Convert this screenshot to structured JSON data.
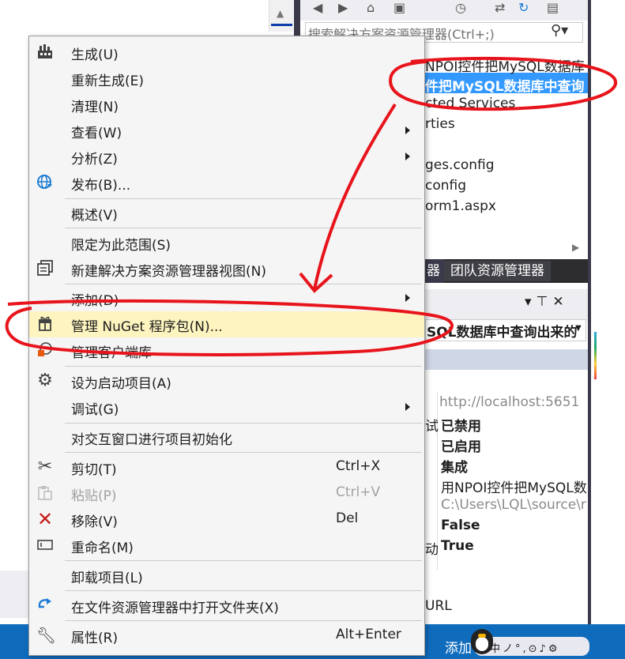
{
  "solution_explorer": {
    "search_placeholder": "搜索解决方案资源管理器(Ctrl+;)",
    "tree": [
      "NPOI控件把MySQL数据库",
      "件把MySQL数据库中查询",
      "cted Services",
      "rties",
      "ges.config",
      "config",
      "orm1.aspx"
    ],
    "tabs": [
      "器",
      "团队资源管理器"
    ]
  },
  "properties": {
    "combo": "SQL数据库中查询出来的",
    "rows": [
      {
        "label": "",
        "value": "http://localhost:5651"
      },
      {
        "label": "试",
        "value": "已禁用"
      },
      {
        "label": "",
        "value": "已启用"
      },
      {
        "label": "",
        "value": "集成"
      },
      {
        "label": "",
        "value": "用NPOI控件把MySQL数"
      },
      {
        "label": "",
        "value": "C:\\Users\\LQL\\source\\r"
      },
      {
        "label": "",
        "value": "False"
      },
      {
        "label": "动",
        "value": "True"
      }
    ],
    "url_label": "URL"
  },
  "taskbar": {
    "add_text": "添加",
    "ime_text": "中ノ°,⊙♪⚙"
  },
  "context_menu": {
    "items": [
      {
        "label": "生成(U)",
        "icon": "build-icon"
      },
      {
        "label": "重新生成(E)"
      },
      {
        "label": "清理(N)"
      },
      {
        "label": "查看(W)",
        "submenu": true
      },
      {
        "label": "分析(Z)",
        "submenu": true
      },
      {
        "label": "发布(B)...",
        "icon": "publish-globe-icon"
      },
      {
        "label": "概述(V)"
      },
      {
        "label": "限定为此范围(S)"
      },
      {
        "label": "新建解决方案资源管理器视图(N)",
        "icon": "new-view-icon"
      },
      {
        "label": "添加(D)",
        "submenu": true
      },
      {
        "label": "管理 NuGet 程序包(N)...",
        "icon": "nuget-icon",
        "highlighted": true
      },
      {
        "label": "管理客户端库",
        "icon": "client-lib-icon"
      },
      {
        "label": "设为启动项目(A)",
        "icon": "gear-icon"
      },
      {
        "label": "调试(G)",
        "submenu": true
      },
      {
        "label": "对交互窗口进行项目初始化"
      },
      {
        "label": "剪切(T)",
        "shortcut": "Ctrl+X",
        "icon": "scissors-icon"
      },
      {
        "label": "粘贴(P)",
        "shortcut": "Ctrl+V",
        "icon": "paste-icon",
        "disabled": true
      },
      {
        "label": "移除(V)",
        "shortcut": "Del",
        "icon": "remove-x-icon"
      },
      {
        "label": "重命名(M)",
        "icon": "rename-icon"
      },
      {
        "label": "卸载项目(L)"
      },
      {
        "label": "在文件资源管理器中打开文件夹(X)",
        "icon": "open-folder-arrow-icon"
      },
      {
        "label": "属性(R)",
        "shortcut": "Alt+Enter",
        "icon": "wrench-icon"
      }
    ]
  },
  "colors": {
    "highlight": "#fdf4bf",
    "selection": "#3399ff",
    "annotation": "#e8141c"
  }
}
